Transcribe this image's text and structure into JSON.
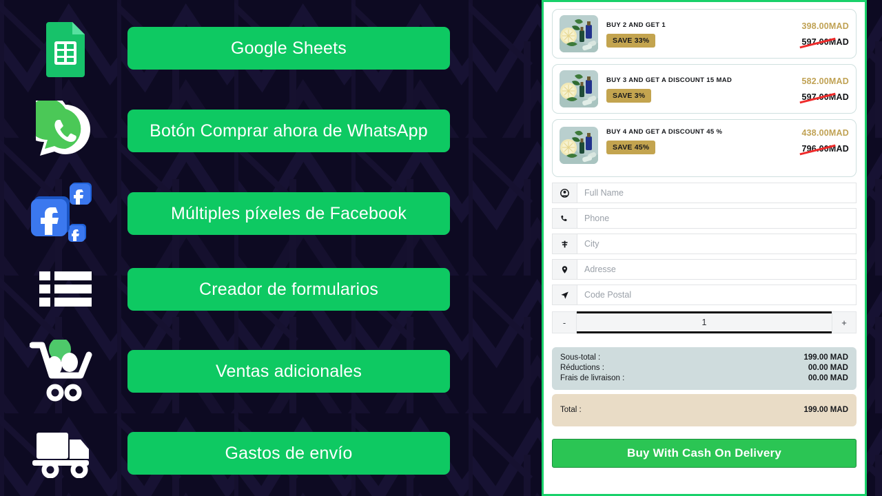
{
  "theme": {
    "bg_dark": "#0d0a22",
    "accent_green": "#0ec962",
    "panel_border_green": "#19d16a",
    "badge_gold": "#c3a44f",
    "price_gold": "#c0a254",
    "strike_red": "#ef2b2b",
    "summary_blue": "#cfdcdd",
    "total_beige": "#e9dcc6",
    "cod_green": "#2bc554"
  },
  "features": [
    {
      "icon": "google-sheets-icon",
      "label": "Google Sheets"
    },
    {
      "icon": "whatsapp-icon",
      "label": "Botón Comprar ahora de WhatsApp"
    },
    {
      "icon": "facebook-pixels-icon",
      "label": "Múltiples píxeles de Facebook"
    },
    {
      "icon": "form-builder-list-icon",
      "label": "Creador de formularios"
    },
    {
      "icon": "upsell-cart-icon",
      "label": "Ventas adicionales"
    },
    {
      "icon": "shipping-truck-icon",
      "label": "Gastos de envío"
    }
  ],
  "checkout": {
    "offers": [
      {
        "title": "BUY 2 AND GET 1",
        "save_badge": "SAVE 33%",
        "price_new": "398.00MAD",
        "price_old": "597.00MAD"
      },
      {
        "title": "BUY 3 AND GET A DISCOUNT 15 MAD",
        "save_badge": "SAVE 3%",
        "price_new": "582.00MAD",
        "price_old": "597.00MAD"
      },
      {
        "title": "BUY 4 AND GET A DISCOUNT 45 %",
        "save_badge": "SAVE 45%",
        "price_new": "438.00MAD",
        "price_old": "796.00MAD"
      }
    ],
    "fields": [
      {
        "icon": "user-icon",
        "placeholder": "Full Name",
        "value": ""
      },
      {
        "icon": "phone-icon",
        "placeholder": "Phone",
        "value": ""
      },
      {
        "icon": "city-icon",
        "placeholder": "City",
        "value": ""
      },
      {
        "icon": "map-pin-icon",
        "placeholder": "Adresse",
        "value": ""
      },
      {
        "icon": "location-arrow-icon",
        "placeholder": "Code Postal",
        "value": ""
      }
    ],
    "quantity": {
      "decrement_label": "-",
      "increment_label": "+",
      "value": "1"
    },
    "summary": {
      "lines": [
        {
          "label": "Sous-total :",
          "value": "199.00 MAD"
        },
        {
          "label": "Réductions :",
          "value": "00.00 MAD"
        },
        {
          "label": "Frais de livraison :",
          "value": "00.00 MAD"
        }
      ],
      "total_label": "Total :",
      "total_value": "199.00 MAD"
    },
    "cod_button_label": "Buy With Cash On Delivery"
  }
}
